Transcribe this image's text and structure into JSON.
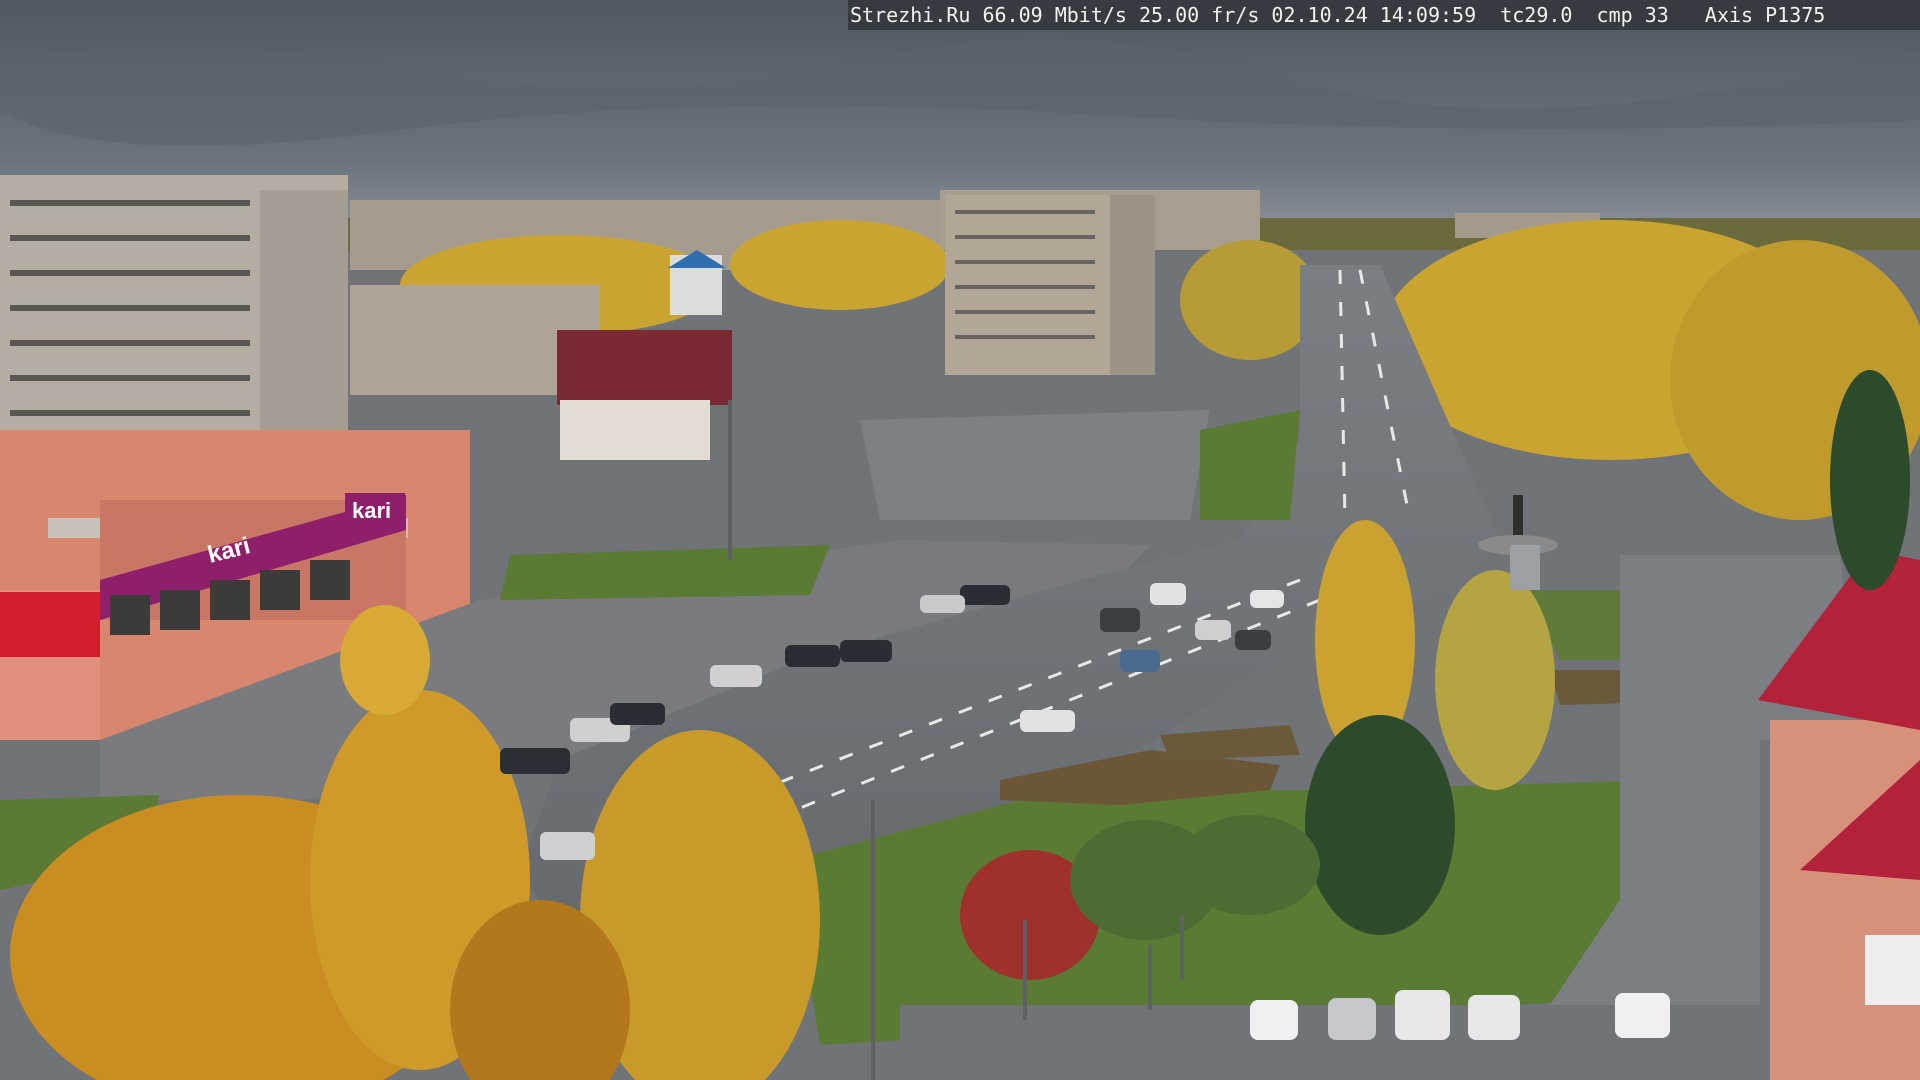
{
  "overlay": {
    "text": "Strezhi.Ru 66.09 Mbit/s 25.00 fr/s 02.10.24 14:09:59  tc29.0  cmp 33   Axis P1375"
  },
  "signs": {
    "kari_top": "kari",
    "kari_front": "kari"
  },
  "colors": {
    "sky": "#606a76",
    "road": "#6f7378",
    "grass": "#5b7a34",
    "foliage": "#c89a2a",
    "signage": "#8e1f6a"
  }
}
